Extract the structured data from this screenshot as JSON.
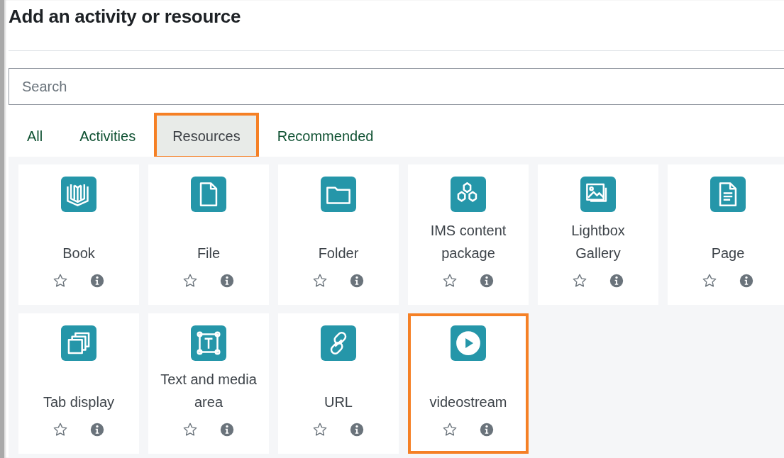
{
  "dialog": {
    "title": "Add an activity or resource"
  },
  "search": {
    "placeholder": "Search"
  },
  "tabs": [
    {
      "label": "All",
      "selected": false,
      "highlighted": false
    },
    {
      "label": "Activities",
      "selected": false,
      "highlighted": false
    },
    {
      "label": "Resources",
      "selected": true,
      "highlighted": true
    },
    {
      "label": "Recommended",
      "selected": false,
      "highlighted": false
    }
  ],
  "items": [
    {
      "name": "Book",
      "starred": false,
      "highlighted": false
    },
    {
      "name": "File",
      "starred": false,
      "highlighted": false
    },
    {
      "name": "Folder",
      "starred": false,
      "highlighted": false
    },
    {
      "name": "IMS content package",
      "starred": false,
      "highlighted": false
    },
    {
      "name": "Lightbox Gallery",
      "starred": false,
      "highlighted": false
    },
    {
      "name": "Page",
      "starred": false,
      "highlighted": false
    },
    {
      "name": "Tab display",
      "starred": false,
      "highlighted": false
    },
    {
      "name": "Text and media area",
      "starred": false,
      "highlighted": false
    },
    {
      "name": "URL",
      "starred": false,
      "highlighted": false
    },
    {
      "name": "videostream",
      "starred": false,
      "highlighted": true
    }
  ]
}
